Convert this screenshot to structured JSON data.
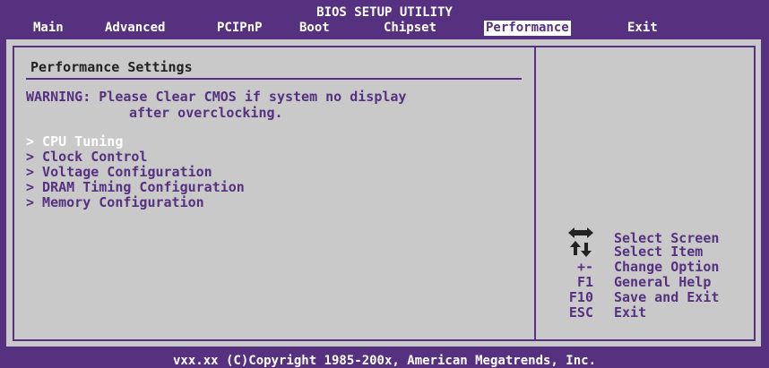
{
  "app": {
    "title": "BIOS SETUP UTILITY"
  },
  "tabs": [
    {
      "label": "Main"
    },
    {
      "label": "Advanced"
    },
    {
      "label": "PCIPnP"
    },
    {
      "label": "Boot"
    },
    {
      "label": "Chipset"
    },
    {
      "label": "Performance",
      "active": true
    },
    {
      "label": "Exit"
    }
  ],
  "main": {
    "heading": "Performance Settings",
    "warning_line1": "WARNING: Please Clear CMOS if system no display",
    "warning_line2": "after overclocking.",
    "items": [
      {
        "label": "> CPU Tuning",
        "selected": true
      },
      {
        "label": "> Clock Control"
      },
      {
        "label": "> Voltage Configuration"
      },
      {
        "label": "> DRAM Timing Configuration"
      },
      {
        "label": "> Memory Configuration"
      }
    ]
  },
  "help": [
    {
      "key_icon": "arrows-left-right-icon",
      "text": "Select Screen"
    },
    {
      "key_icon": "arrows-up-down-icon",
      "text": "Select Item"
    },
    {
      "key": "+-",
      "text": "Change Option"
    },
    {
      "key": "F1",
      "text": "General Help"
    },
    {
      "key": "F10",
      "text": "Save and Exit"
    },
    {
      "key": "ESC",
      "text": "Exit"
    }
  ],
  "footer": "vxx.xx (C)Copyright 1985-200x, American Megatrends, Inc.",
  "colors": {
    "background": "#55317f",
    "panel": "#c9c9c9",
    "text": "#55317f",
    "highlight": "#ffffff"
  }
}
